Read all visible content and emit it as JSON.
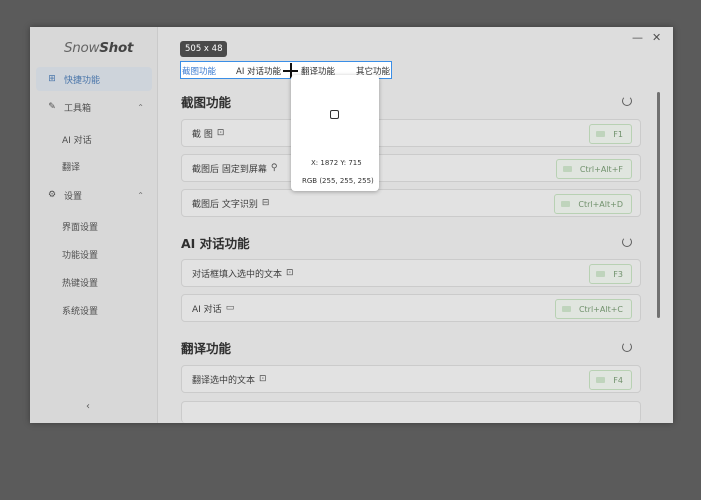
{
  "app": {
    "logo_snow": "Snow",
    "logo_shot": "Shot",
    "minimize": "—",
    "close": "✕"
  },
  "sidebar": {
    "items": [
      {
        "label": "快捷功能",
        "icon": "grid-icon",
        "glyph": "⊞"
      },
      {
        "label": "工具箱",
        "icon": "wrench-icon",
        "glyph": "✎",
        "chevron": "⌃"
      },
      {
        "label": "AI 对话"
      },
      {
        "label": "翻译"
      },
      {
        "label": "设置",
        "icon": "gear-icon",
        "glyph": "⚙",
        "chevron": "⌃"
      },
      {
        "label": "界面设置"
      },
      {
        "label": "功能设置"
      },
      {
        "label": "热键设置"
      },
      {
        "label": "系统设置"
      }
    ],
    "collapse_glyph": "‹"
  },
  "sections": [
    {
      "title": "截图功能",
      "rows": [
        {
          "label": "截 图",
          "icon": "⊡",
          "key": "F1"
        },
        {
          "label": "截图后 固定到屏幕",
          "icon": "⚲",
          "key": "Ctrl+Alt+F"
        },
        {
          "label": "截图后 文字识别",
          "icon": "⊟",
          "key": "Ctrl+Alt+D"
        }
      ]
    },
    {
      "title": "AI 对话功能",
      "rows": [
        {
          "label": "对话框填入选中的文本",
          "icon": "⊡",
          "key": "F3"
        },
        {
          "label": "AI 对话",
          "icon": "▭",
          "key": "Ctrl+Alt+C"
        }
      ]
    },
    {
      "title": "翻译功能",
      "rows": [
        {
          "label": "翻译选中的文本",
          "icon": "⊡",
          "key": "F4"
        }
      ]
    }
  ],
  "overlay": {
    "size_label": "505 x 48",
    "sel_tabs": [
      "截图功能",
      "AI 对话功能",
      "翻译功能",
      "其它功能"
    ],
    "coords": "X: 1872 Y: 715",
    "rgb": "RGB (255, 255, 255)"
  },
  "colors": {
    "accent": "#3b7bd1",
    "key_border": "#c8e3c3",
    "key_text": "#7b9e76"
  }
}
